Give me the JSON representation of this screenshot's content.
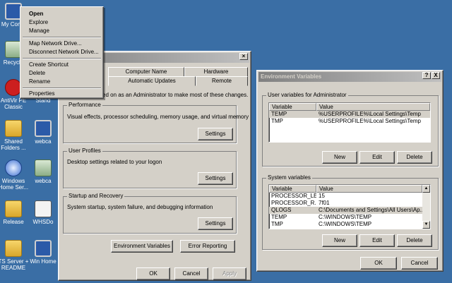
{
  "desktop": {
    "icons": [
      {
        "label": "My Comp",
        "icon": "computer-icon"
      },
      {
        "label": "Recycle",
        "icon": "recycle-bin-icon"
      },
      {
        "label": "AntiVir PE Classic",
        "icon": "antivir-icon"
      },
      {
        "label": "Shared Folders ...",
        "icon": "shared-folders-icon"
      },
      {
        "label": "Windows Home Ser...",
        "icon": "windows-home-server-icon"
      },
      {
        "label": "Release",
        "icon": "folder-icon"
      },
      {
        "label": "TS Server + README",
        "icon": "folder-icon"
      },
      {
        "label": "Stand",
        "icon": "shortcut-icon"
      },
      {
        "label": "webca",
        "icon": "webcam-icon"
      },
      {
        "label": "webca",
        "icon": "webcam-icon"
      },
      {
        "label": "WHSDo",
        "icon": "document-icon"
      },
      {
        "label": "Win Home",
        "icon": "monitor-icon"
      }
    ]
  },
  "context_menu": {
    "items": [
      "Open",
      "Explore",
      "Manage",
      "Map Network Drive...",
      "Disconnect Network Drive...",
      "Create Shortcut",
      "Delete",
      "Rename",
      "Properties"
    ]
  },
  "system_properties": {
    "tabs_top": [
      "Computer Name",
      "Hardware"
    ],
    "tabs_bottom": [
      "Automatic Updates",
      "Remote"
    ],
    "intro": "ed on as an Administrator to make most of these changes.",
    "performance": {
      "title": "Performance",
      "desc": "Visual effects, processor scheduling, memory usage, and virtual memory",
      "button": "Settings"
    },
    "user_profiles": {
      "title": "User Profiles",
      "desc": "Desktop settings related to your logon",
      "button": "Settings"
    },
    "startup": {
      "title": "Startup and Recovery",
      "desc": "System startup, system failure, and debugging information",
      "button": "Settings"
    },
    "env_button": "Environment Variables",
    "error_button": "Error Reporting",
    "ok": "OK",
    "cancel": "Cancel",
    "apply": "Apply"
  },
  "env_vars": {
    "title": "Environment Variables",
    "help": "?",
    "close": "X",
    "user_section": "User variables for Administrator",
    "columns": [
      "Variable",
      "Value"
    ],
    "user_vars": [
      {
        "name": "TEMP",
        "value": "%USERPROFILE%\\Local Settings\\Temp"
      },
      {
        "name": "TMP",
        "value": "%USERPROFILE%\\Local Settings\\Temp"
      }
    ],
    "system_section": "System variables",
    "system_vars": [
      {
        "name": "PROCESSOR_LE...",
        "value": "15"
      },
      {
        "name": "PROCESSOR_R...",
        "value": "7f01"
      },
      {
        "name": "QLOGS",
        "value": "C:\\Documents and Settings\\All Users\\Ap..."
      },
      {
        "name": "TEMP",
        "value": "C:\\WINDOWS\\TEMP"
      },
      {
        "name": "TMP",
        "value": "C:\\WINDOWS\\TEMP"
      }
    ],
    "new": "New",
    "edit": "Edit",
    "delete": "Delete",
    "ok": "OK",
    "cancel": "Cancel"
  },
  "colors": {
    "desktop": "#3a6ea5",
    "window_face": "#d4d0c8",
    "titlebar_inactive": "#808080"
  }
}
